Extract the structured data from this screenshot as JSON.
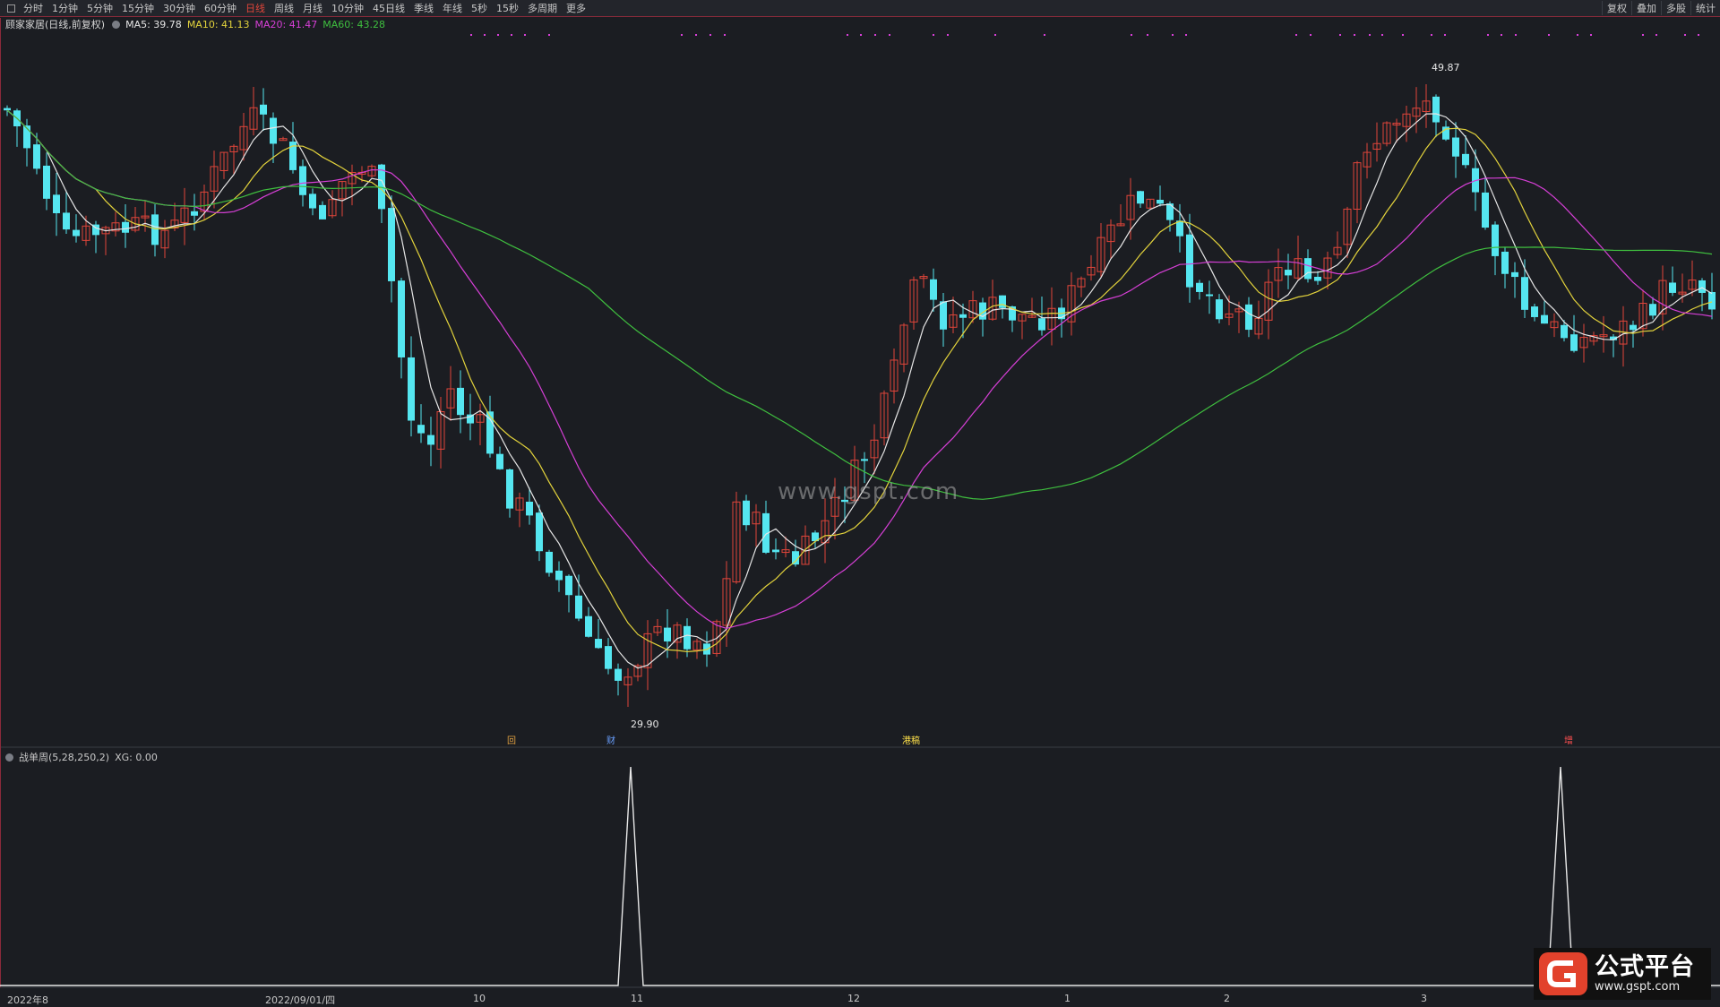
{
  "toolbar": {
    "items": [
      "分时",
      "1分钟",
      "5分钟",
      "15分钟",
      "30分钟",
      "60分钟",
      "日线",
      "周线",
      "月线",
      "10分钟",
      "45日线",
      "季线",
      "年线",
      "5秒",
      "15秒",
      "多周期",
      "更多"
    ],
    "active": "日线",
    "right_items": [
      "复权",
      "叠加",
      "多股",
      "统计"
    ]
  },
  "info": {
    "title": "顾家家居(日线,前复权)",
    "ma5": "MA5: 39.78",
    "ma10": "MA10: 41.13",
    "ma20": "MA20: 41.47",
    "ma60": "MA60: 43.28"
  },
  "colors": {
    "ma5": "#e6e6e6",
    "ma10": "#e3d33c",
    "ma20": "#d63fd6",
    "ma60": "#3fbf3f",
    "up": "#e0453a",
    "down": "#55e6f0",
    "xg": "#e8e8e8"
  },
  "annotations": {
    "high": "49.87",
    "low": "29.90"
  },
  "events": [
    {
      "text": "回",
      "color": "#e0a040"
    },
    {
      "text": "财",
      "color": "#6aa0ff"
    },
    {
      "text": "港稿",
      "color": "#ffe14a"
    },
    {
      "text": "增",
      "color": "#ff5050"
    }
  ],
  "indicator": {
    "name": "战单周(5,28,250,2)",
    "xg": "XG: 0.00"
  },
  "xaxis": [
    "2022年8",
    "2022/09/01/四",
    "10",
    "11",
    "12",
    "1",
    "2",
    "3"
  ],
  "watermark": "www.gspt.com",
  "logo": {
    "title": "公式平台",
    "url": "www.gspt.com"
  }
}
